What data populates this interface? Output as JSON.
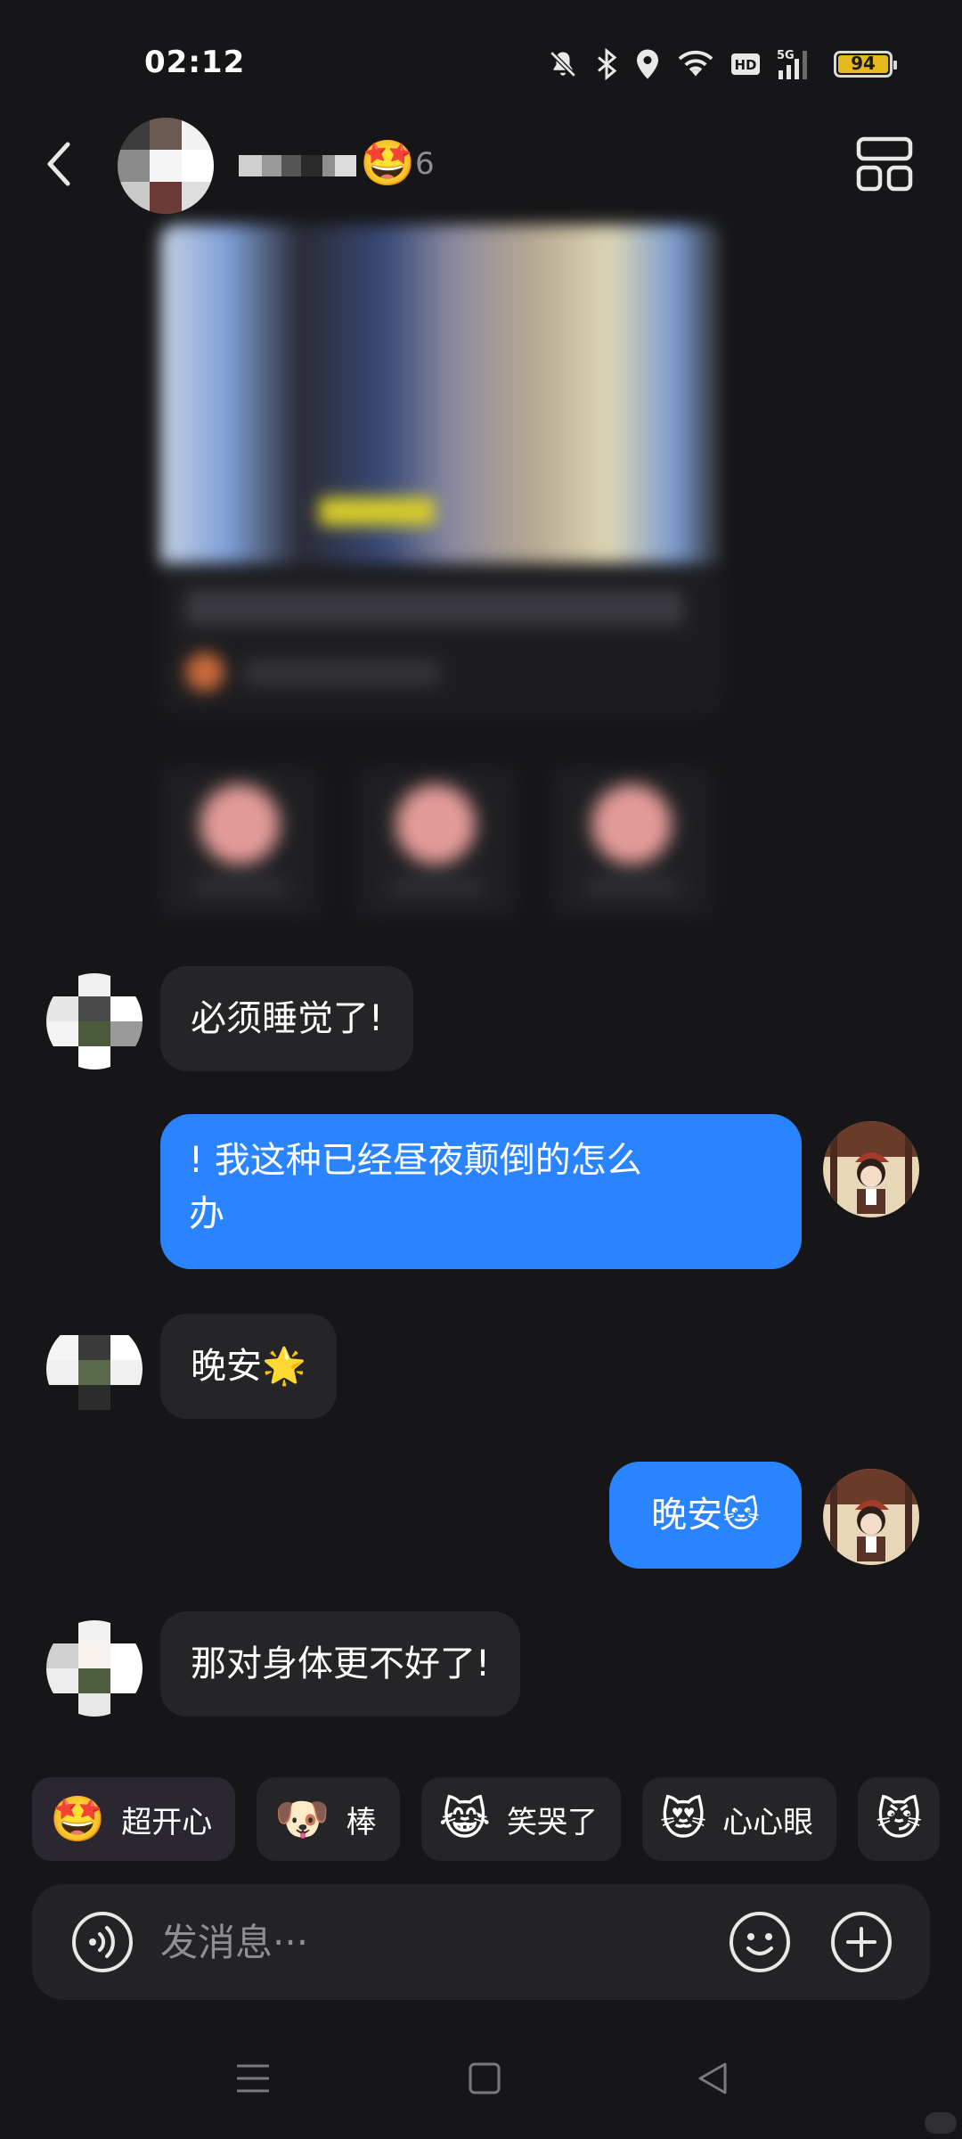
{
  "status_bar": {
    "time": "02:12",
    "battery": "94",
    "icons": [
      "bell-muted-icon",
      "bluetooth-icon",
      "location-icon",
      "wifi-icon",
      "hd-icon",
      "5g-signal-icon",
      "battery-icon"
    ]
  },
  "header": {
    "name_emoji": "🤩",
    "level": "6",
    "back_icon": "chevron-left-icon",
    "layout_icon": "layout-grid-icon"
  },
  "messages": [
    {
      "side": "incoming",
      "text": "必须睡觉了!"
    },
    {
      "side": "outgoing",
      "line1": "!  我这种已经昼夜颠倒的怎么",
      "line2": "办"
    },
    {
      "side": "incoming",
      "text": "晚安",
      "emoji": "🌟"
    },
    {
      "side": "outgoing",
      "text": "晚安",
      "emoji": "🐱"
    },
    {
      "side": "incoming",
      "text": "那对身体更不好了!"
    }
  ],
  "quick_reactions": [
    {
      "emoji": "🤩",
      "label": "超开心"
    },
    {
      "emoji": "🐶",
      "label": "棒"
    },
    {
      "emoji": "😹",
      "label": "笑哭了"
    },
    {
      "emoji": "😻",
      "label": "心心眼"
    },
    {
      "emoji": "😼",
      "label": ""
    }
  ],
  "input": {
    "placeholder": "发消息···"
  },
  "colors": {
    "background": "#161618",
    "bubble_incoming": "#252528",
    "bubble_outgoing": "#2a84ff"
  }
}
